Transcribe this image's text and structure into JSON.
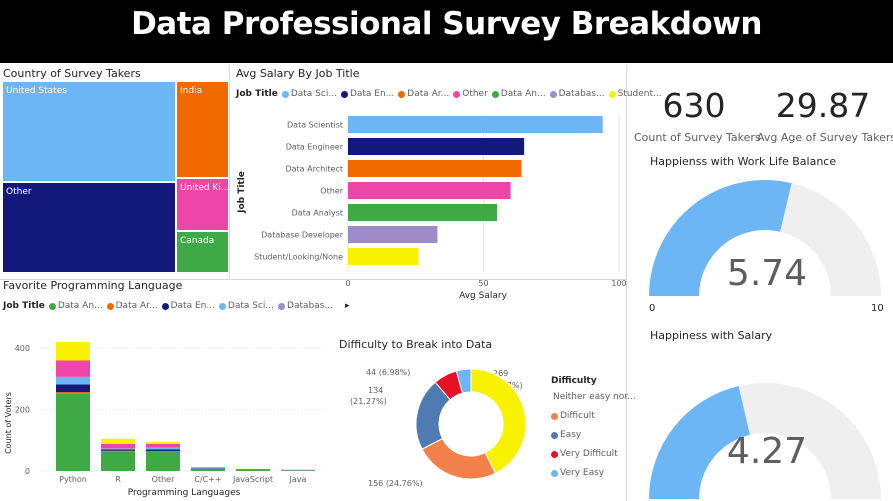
{
  "header": {
    "title": "Data Professional Survey Breakdown"
  },
  "colors": {
    "light_blue": "#6cb6f5",
    "dark_blue": "#12197a",
    "orange": "#f06a00",
    "pink": "#ee45a8",
    "green": "#3faa45",
    "lavender": "#9e8bc9",
    "yellow": "#f8f200",
    "gauge_track": "#efefef",
    "slate_blue": "#4f7bb2",
    "red": "#e81123",
    "orange2": "#f1804b"
  },
  "treemap": {
    "title": "Country of Survey Takers",
    "cells": [
      {
        "label": "United States",
        "color": "#6cb6f5"
      },
      {
        "label": "Other",
        "color": "#12197a"
      },
      {
        "label": "India",
        "color": "#f06a00"
      },
      {
        "label": "United Ki...",
        "color": "#ee45a8"
      },
      {
        "label": "Canada",
        "color": "#3faa45"
      }
    ]
  },
  "salary_chart": {
    "title": "Avg Salary By Job Title",
    "legend_title": "Job Title",
    "legend": [
      {
        "label": "Data Sci...",
        "color": "#6cb6f5"
      },
      {
        "label": "Data En...",
        "color": "#12197a"
      },
      {
        "label": "Data Ar...",
        "color": "#f06a00"
      },
      {
        "label": "Other",
        "color": "#ee45a8"
      },
      {
        "label": "Data An...",
        "color": "#3faa45"
      },
      {
        "label": "Databas...",
        "color": "#9e8bc9"
      },
      {
        "label": "Student...",
        "color": "#f8f200"
      }
    ],
    "ylabel": "Job Title",
    "xlabel": "Avg Salary"
  },
  "language_chart": {
    "title": "Favorite Programming Language",
    "legend_title": "Job Title",
    "legend": [
      {
        "label": "Data An...",
        "color": "#3faa45"
      },
      {
        "label": "Data Ar...",
        "color": "#f06a00"
      },
      {
        "label": "Data En...",
        "color": "#12197a"
      },
      {
        "label": "Data Sci...",
        "color": "#6cb6f5"
      },
      {
        "label": "Databas...",
        "color": "#9e8bc9"
      }
    ],
    "legend_more": "▸",
    "ylabel": "Count of Voters",
    "xlabel": "Programming Languages"
  },
  "donut": {
    "title": "Difficulty to Break into Data",
    "legend_title": "Difficulty",
    "legend": [
      {
        "label": "Neither easy nor...",
        "color": "#f8f200"
      },
      {
        "label": "Difficult",
        "color": "#f1804b"
      },
      {
        "label": "Easy",
        "color": "#4f7bb2"
      },
      {
        "label": "Very Difficult",
        "color": "#e81123"
      },
      {
        "label": "Very Easy",
        "color": "#6cb6f5"
      }
    ],
    "labels": {
      "neither_1": "269",
      "neither_2": "(42.7%)",
      "difficult": "156 (24.76%)",
      "easy_1": "134",
      "easy_2": "(21.27%)",
      "very_difficult": "44 (6.98%)"
    }
  },
  "kpis": {
    "count": {
      "value": "630",
      "label": "Count of Survey Takers"
    },
    "age": {
      "value": "29.87",
      "label": "Avg Age of Survey Takers"
    }
  },
  "gauges": {
    "work_life": {
      "title": "Happienss with Work Life Balance",
      "value_text": "5.74",
      "min": "0",
      "max": "10"
    },
    "salary": {
      "title": "Happiness with Salary",
      "value_text": "4.27",
      "min": "0",
      "max": "10"
    }
  },
  "chart_data": [
    {
      "type": "bar",
      "orientation": "horizontal",
      "title": "Avg Salary By Job Title",
      "xlabel": "Avg Salary",
      "ylabel": "Job Title",
      "categories": [
        "Data Scientist",
        "Data Engineer",
        "Data Architect",
        "Other",
        "Data Analyst",
        "Database Developer",
        "Student/Looking/None"
      ],
      "values": [
        94,
        65,
        64,
        60,
        55,
        33,
        26
      ],
      "colors": [
        "#6cb6f5",
        "#12197a",
        "#f06a00",
        "#ee45a8",
        "#3faa45",
        "#9e8bc9",
        "#f8f200"
      ],
      "xlim": [
        0,
        100
      ],
      "xticks": [
        "0",
        "50",
        "100"
      ],
      "grid": true
    },
    {
      "type": "bar",
      "stacked": true,
      "title": "Favorite Programming Language",
      "xlabel": "Programming Languages",
      "ylabel": "Count of Voters",
      "categories": [
        "Python",
        "R",
        "Other",
        "C/C++",
        "JavaScript",
        "Java"
      ],
      "ylim": [
        0,
        430
      ],
      "yticks": [
        "0",
        "200",
        "400"
      ],
      "series": [
        {
          "name": "Data An...",
          "color": "#3faa45",
          "values": [
            253,
            64,
            62,
            7,
            4,
            2
          ]
        },
        {
          "name": "Data Ar...",
          "color": "#f06a00",
          "values": [
            4,
            2,
            3,
            0,
            0,
            0
          ]
        },
        {
          "name": "Data En...",
          "color": "#12197a",
          "values": [
            25,
            4,
            5,
            1,
            1,
            0
          ]
        },
        {
          "name": "Data Sci...",
          "color": "#6cb6f5",
          "values": [
            22,
            3,
            5,
            1,
            0,
            1
          ]
        },
        {
          "name": "Databas...",
          "color": "#9e8bc9",
          "values": [
            3,
            1,
            2,
            1,
            0,
            0
          ]
        },
        {
          "name": "",
          "color": "#ee45a8",
          "values": [
            53,
            14,
            11,
            2,
            1,
            1
          ]
        },
        {
          "name": "",
          "color": "#f8f200",
          "values": [
            60,
            17,
            7,
            1,
            1,
            0
          ]
        }
      ]
    },
    {
      "type": "pie",
      "donut": true,
      "title": "Difficulty to Break into Data",
      "categories": [
        "Neither easy nor difficult",
        "Difficult",
        "Easy",
        "Very Difficult",
        "Very Easy"
      ],
      "values": [
        269,
        156,
        134,
        44,
        27
      ],
      "colors": [
        "#f8f200",
        "#f1804b",
        "#4f7bb2",
        "#e81123",
        "#6cb6f5"
      ]
    },
    {
      "type": "gauge",
      "title": "Happienss with Work Life Balance",
      "value": 5.74,
      "min": 0,
      "max": 10
    },
    {
      "type": "gauge",
      "title": "Happiness with Salary",
      "value": 4.27,
      "min": 0,
      "max": 10
    }
  ]
}
